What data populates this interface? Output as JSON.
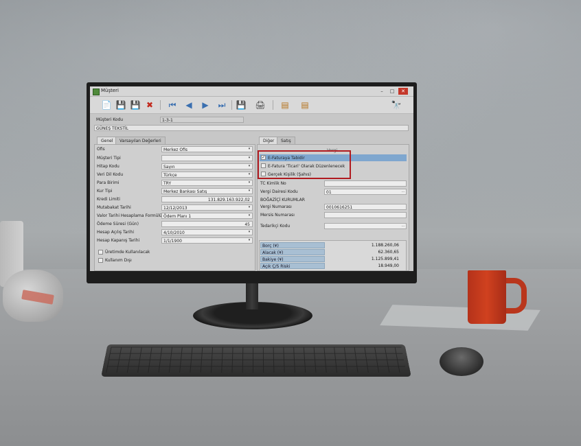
{
  "window": {
    "title": "Müşteri",
    "min": "–",
    "max": "□",
    "close": "✕"
  },
  "toolbar": {
    "new": "📄",
    "save": "💾",
    "save_close": "💾",
    "delete": "✖",
    "first": "⏮",
    "prev": "◀",
    "next": "▶",
    "last": "⏭",
    "export": "💾",
    "print": "🖨",
    "report1": "▤",
    "report2": "▤",
    "search": "🔭"
  },
  "header": {
    "kod_label": "Müşteri Kodu",
    "kod_value": "1-3-1",
    "name_value": "GÜNEŞ TEKSTİL"
  },
  "left_tabs": [
    "Genel",
    "Varsayılan Değerleri"
  ],
  "left_fields": [
    {
      "label": "Ofis",
      "value": ""
    },
    {
      "label": "Müşteri Tipi",
      "value": ""
    },
    {
      "label": "Hitap Kodu",
      "value": "Sayın"
    },
    {
      "label": "Veri Dil Kodu",
      "value": "Türkçe"
    },
    {
      "label": "Para Birimi",
      "value": "TRY"
    },
    {
      "label": "Kur Tipi",
      "value": "Merkez Bankası Satış"
    },
    {
      "label": "Kredi Limiti",
      "value": "131.829.163.922,02"
    },
    {
      "label": "Mutabakat Tarihi",
      "value": "12/12/2013"
    },
    {
      "label": "Valor Tarihi Hesaplama Formülü",
      "value": "Ödem Planı 1"
    },
    {
      "label": "Ödeme Süresi (Gün)",
      "value": "45"
    },
    {
      "label": "Hesap Açılış Tarihi",
      "value": "4/10/2010"
    },
    {
      "label": "Hesap Kapanış Tarihi",
      "value": "1/1/1900"
    }
  ],
  "ofis_value": "Merkez Ofis",
  "left_checks": [
    {
      "label": "Üretimde Kullanılacak",
      "checked": false
    },
    {
      "label": "Kullanım Dışı",
      "checked": false
    }
  ],
  "right_tabs": [
    "Diğer",
    "Satış"
  ],
  "right_group_label": "Vergi",
  "right_checks": [
    {
      "label": "E-Faturaya Tabidir",
      "checked": true
    },
    {
      "label": "E-Fatura 'Ticari' Olarak Düzenlenecek",
      "checked": false
    },
    {
      "label": "Gerçek Kişilik (Şahıs)",
      "checked": false
    }
  ],
  "right_fields": [
    {
      "label": "TC Kimlik No",
      "value": ""
    },
    {
      "label": "Vergi Dairesi Kodu",
      "value": "01"
    },
    {
      "label": "BOĞAZİÇİ KURUMLAR",
      "value": ""
    },
    {
      "label": "Vergi Numarası",
      "value": "0010616251"
    },
    {
      "label": "Mersis Numarası",
      "value": ""
    },
    {
      "label": "Tedarikçi Kodu",
      "value": ""
    }
  ],
  "summary": [
    {
      "label": "Borç (¥)",
      "value": "1.188.260,06"
    },
    {
      "label": "Alacak (¥)",
      "value": "62.360,65"
    },
    {
      "label": "Bakiye (¥)",
      "value": "1.125.899,41"
    },
    {
      "label": "Açık Ç/S Riski",
      "value": "18.949,00"
    }
  ],
  "colors": {
    "highlight": "#b01a20",
    "mug": "#d0411f"
  }
}
